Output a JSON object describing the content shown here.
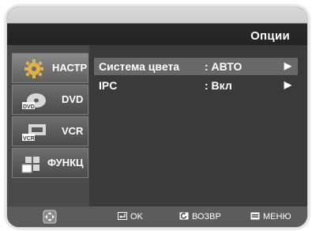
{
  "title": "Опции",
  "sidebar": {
    "items": [
      {
        "label": "НАСТР",
        "icon": "gear-icon",
        "active": true
      },
      {
        "label": "DVD",
        "icon": "dvd-disc-icon",
        "active": false
      },
      {
        "label": "VCR",
        "icon": "vcr-cassette-icon",
        "active": false
      },
      {
        "label": "ФУНКЦ",
        "icon": "function-blocks-icon",
        "active": false
      }
    ]
  },
  "options": [
    {
      "name": "Система цвета",
      "value": ": АВТО",
      "arrow": "▶",
      "selected": true
    },
    {
      "name": "IPC",
      "value": ": Вкл",
      "arrow": "▶",
      "selected": false
    }
  ],
  "footer": {
    "nav_icon": "directional-pad-icon",
    "ok": {
      "label": "OK",
      "icon": "enter-icon"
    },
    "back": {
      "label": "ВОЗВР",
      "icon": "return-icon"
    },
    "menu": {
      "label": "МЕНЮ",
      "icon": "menu-icon"
    }
  }
}
